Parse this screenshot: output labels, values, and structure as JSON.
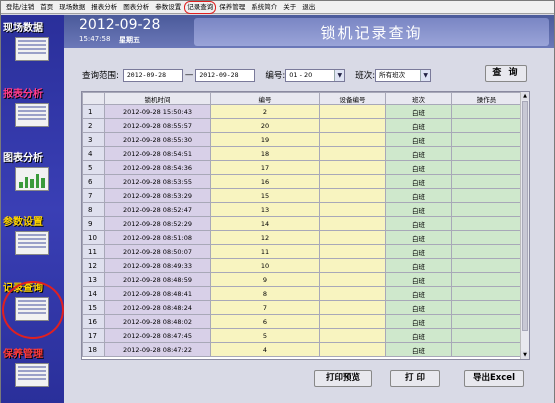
{
  "menu": {
    "items": [
      "登陆/注销",
      "首页",
      "现场数据",
      "报表分析",
      "图表分析",
      "参数设置",
      "记录查询",
      "保养管理",
      "系统简介",
      "关于",
      "退出"
    ],
    "highlighted_index": 6
  },
  "sidebar": {
    "items": [
      {
        "label": "现场数据",
        "color": "#ffffff"
      },
      {
        "label": "报表分析",
        "color": "#ff3b8a"
      },
      {
        "label": "图表分析",
        "color": "#ffffff"
      },
      {
        "label": "参数设置",
        "color": "#ffd400"
      },
      {
        "label": "记录查询",
        "color": "#ffd400"
      },
      {
        "label": "保养管理",
        "color": "#ff3b3b"
      }
    ],
    "highlighted": "记录查询"
  },
  "header": {
    "date": "2012-09-28",
    "time": "15:47:58",
    "weekday": "星期五",
    "page_title": "锁机记录查询"
  },
  "search": {
    "range_label": "查询范围:",
    "start_date": "2012-09-28",
    "end_date": "2012-09-28",
    "number_label": "编号:",
    "number_value": "01 - 20",
    "shift_label": "班次:",
    "shift_value": "所有班次",
    "query_button": "查 询"
  },
  "table": {
    "columns": [
      "",
      "锁机时间",
      "编号",
      "设备编号",
      "班次",
      "操作员"
    ],
    "rows": [
      {
        "idx": "1",
        "time": "2012-09-28 15:50:43",
        "num": "2",
        "dev": "",
        "shift": "白班",
        "op": ""
      },
      {
        "idx": "2",
        "time": "2012-09-28 08:55:57",
        "num": "20",
        "dev": "",
        "shift": "白班",
        "op": ""
      },
      {
        "idx": "3",
        "time": "2012-09-28 08:55:30",
        "num": "19",
        "dev": "",
        "shift": "白班",
        "op": ""
      },
      {
        "idx": "4",
        "time": "2012-09-28 08:54:51",
        "num": "18",
        "dev": "",
        "shift": "白班",
        "op": ""
      },
      {
        "idx": "5",
        "time": "2012-09-28 08:54:36",
        "num": "17",
        "dev": "",
        "shift": "白班",
        "op": ""
      },
      {
        "idx": "6",
        "time": "2012-09-28 08:53:55",
        "num": "16",
        "dev": "",
        "shift": "白班",
        "op": ""
      },
      {
        "idx": "7",
        "time": "2012-09-28 08:53:29",
        "num": "15",
        "dev": "",
        "shift": "白班",
        "op": ""
      },
      {
        "idx": "8",
        "time": "2012-09-28 08:52:47",
        "num": "13",
        "dev": "",
        "shift": "白班",
        "op": ""
      },
      {
        "idx": "9",
        "time": "2012-09-28 08:52:29",
        "num": "14",
        "dev": "",
        "shift": "白班",
        "op": ""
      },
      {
        "idx": "10",
        "time": "2012-09-28 08:51:08",
        "num": "12",
        "dev": "",
        "shift": "白班",
        "op": ""
      },
      {
        "idx": "11",
        "time": "2012-09-28 08:50:07",
        "num": "11",
        "dev": "",
        "shift": "白班",
        "op": ""
      },
      {
        "idx": "12",
        "time": "2012-09-28 08:49:33",
        "num": "10",
        "dev": "",
        "shift": "白班",
        "op": ""
      },
      {
        "idx": "13",
        "time": "2012-09-28 08:48:59",
        "num": "9",
        "dev": "",
        "shift": "白班",
        "op": ""
      },
      {
        "idx": "14",
        "time": "2012-09-28 08:48:41",
        "num": "8",
        "dev": "",
        "shift": "白班",
        "op": ""
      },
      {
        "idx": "15",
        "time": "2012-09-28 08:48:24",
        "num": "7",
        "dev": "",
        "shift": "白班",
        "op": ""
      },
      {
        "idx": "16",
        "time": "2012-09-28 08:48:02",
        "num": "6",
        "dev": "",
        "shift": "白班",
        "op": ""
      },
      {
        "idx": "17",
        "time": "2012-09-28 08:47:45",
        "num": "5",
        "dev": "",
        "shift": "白班",
        "op": ""
      },
      {
        "idx": "18",
        "time": "2012-09-28 08:47:22",
        "num": "4",
        "dev": "",
        "shift": "白班",
        "op": ""
      }
    ]
  },
  "buttons": {
    "print_preview": "打印预览",
    "print": "打 印",
    "export_excel": "导出Excel"
  }
}
